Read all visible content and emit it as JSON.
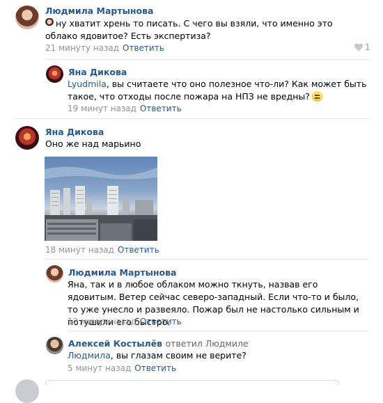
{
  "comments": [
    {
      "author": "Людмила Мартынова",
      "text": "ну хватит хрень то писать. С чего вы взяли, что именно это облако ядовитое? Есть экспертиза?",
      "time": "21 минуту назад",
      "reply": "Ответить",
      "likes": "1"
    },
    {
      "author": "Яна Дикова",
      "mention": "Lyudmila",
      "text": ", вы считаете что оно полезное что-ли? Как может быть такое, что отходы после пожара на НПЗ не вредны?",
      "time": "19 минут назад",
      "reply": "Ответить"
    },
    {
      "author": "Яна Дикова",
      "text": "Оно же над марьино",
      "time": "18 минут назад",
      "reply": "Ответить"
    },
    {
      "author": "Людмила Мартынова",
      "text": "Яна, так и в любое облаком можно ткнуть, назвав его ядовитым. Ветер сейчас северо-западный. Если что-то и было, то уже унесло и развеяло. Пожар был не настолько сильным и потушили его быстро.",
      "time": "12 минут назад",
      "reply": "Ответить"
    },
    {
      "author": "Алексей Костылёв",
      "replied_to": "ответил Людмиле",
      "mention": "Людмила",
      "text": ", вы глазам своим не верите?",
      "time": "5 минут назад",
      "reply": "Ответить"
    }
  ],
  "colors": {
    "link": "#2a5885",
    "meta": "#939393",
    "separator": "#e7e8ec"
  }
}
